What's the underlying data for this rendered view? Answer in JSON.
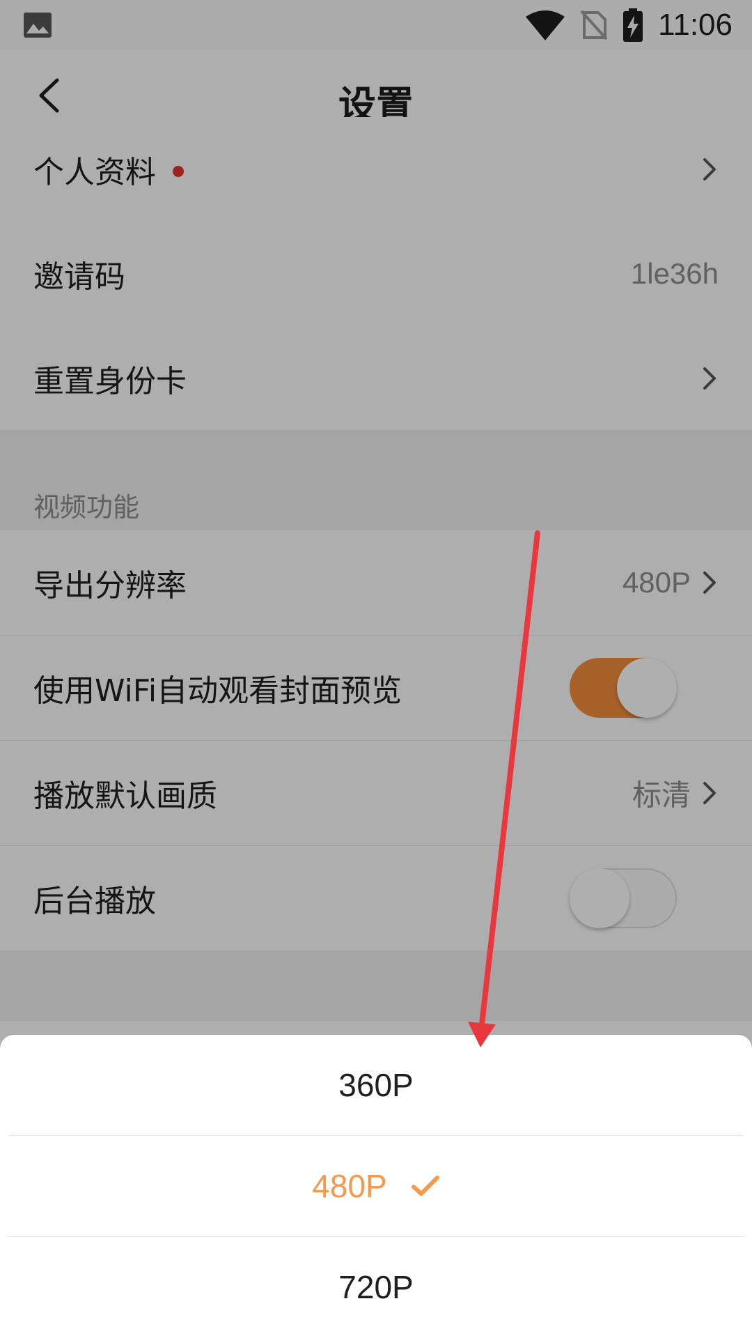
{
  "status_bar": {
    "time": "11:06",
    "left_icon": "image-icon",
    "icons": [
      "wifi-icon",
      "no-sim-icon",
      "battery-charging-icon"
    ]
  },
  "navbar": {
    "title": "设置",
    "back_icon": "back-chevron-icon"
  },
  "account": {
    "profile": {
      "label": "个人资料",
      "has_red_dot": true
    },
    "invite_code": {
      "label": "邀请码",
      "value": "1le36h"
    },
    "reset_id_card": {
      "label": "重置身份卡"
    }
  },
  "video_section": {
    "title": "视频功能",
    "export_resolution": {
      "label": "导出分辨率",
      "value": "480P"
    },
    "wifi_autoplay_preview": {
      "label": "使用WiFi自动观看封面预览",
      "enabled": true
    },
    "default_quality": {
      "label": "播放默认画质",
      "value": "标清"
    },
    "background_play": {
      "label": "后台播放",
      "enabled": false
    }
  },
  "resolution_sheet": {
    "options": [
      {
        "label": "360P",
        "selected": false
      },
      {
        "label": "480P",
        "selected": true
      },
      {
        "label": "720P",
        "selected": false
      }
    ]
  },
  "colors": {
    "accent": "#f39a4c",
    "toggle_on": "#f08b3c",
    "red_dot": "#e0322f",
    "annotation_arrow": "#e8383d"
  }
}
